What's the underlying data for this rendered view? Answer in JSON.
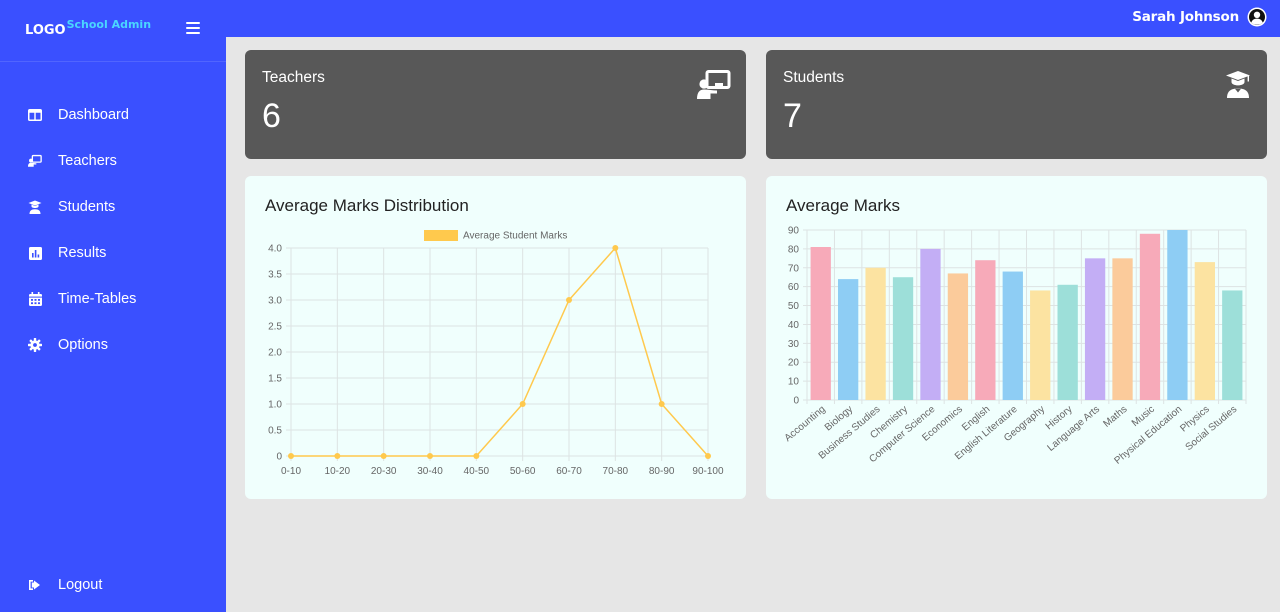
{
  "brand": {
    "logo": "LOGO",
    "app_name": "School Admin"
  },
  "sidebar": {
    "items": [
      {
        "label": "Dashboard",
        "icon": "dashboard-icon"
      },
      {
        "label": "Teachers",
        "icon": "teacher-icon"
      },
      {
        "label": "Students",
        "icon": "student-icon"
      },
      {
        "label": "Results",
        "icon": "chart-icon"
      },
      {
        "label": "Time-Tables",
        "icon": "calendar-icon"
      },
      {
        "label": "Options",
        "icon": "gear-icon"
      }
    ],
    "logout_label": "Logout"
  },
  "user": {
    "name": "Sarah Johnson"
  },
  "stats": {
    "teachers": {
      "title": "Teachers",
      "value": "6"
    },
    "students": {
      "title": "Students",
      "value": "7"
    }
  },
  "charts": {
    "distribution_title": "Average Marks Distribution",
    "marks_title": "Average Marks"
  },
  "colors": {
    "primary": "#3a50ff",
    "card_dark": "#585858",
    "chart_bg": "#f0fffd",
    "line": "#ffc94d"
  },
  "chart_data": [
    {
      "type": "line",
      "title": "Average Marks Distribution",
      "categories": [
        "0-10",
        "10-20",
        "20-30",
        "30-40",
        "40-50",
        "50-60",
        "60-70",
        "70-80",
        "80-90",
        "90-100"
      ],
      "series": [
        {
          "name": "Average Student Marks",
          "values": [
            0,
            0,
            0,
            0,
            0,
            1,
            3,
            4,
            1,
            0
          ]
        }
      ],
      "ylim": [
        0,
        4
      ],
      "yticks": [
        "0",
        "0.5",
        "1.0",
        "1.5",
        "2.0",
        "2.5",
        "3.0",
        "3.5",
        "4.0"
      ],
      "grid": true,
      "legend": "top"
    },
    {
      "type": "bar",
      "title": "Average Marks",
      "categories": [
        "Accounting",
        "Biology",
        "Business Studies",
        "Chemistry",
        "Computer Science",
        "Economics",
        "English",
        "English Literature",
        "Geography",
        "History",
        "Language Arts",
        "Maths",
        "Music",
        "Physical Education",
        "Physics",
        "Social Studies"
      ],
      "values": [
        81,
        64,
        70,
        65,
        80,
        67,
        74,
        68,
        58,
        61,
        75,
        75,
        88,
        90,
        73,
        58
      ],
      "ylim": [
        0,
        90
      ],
      "yticks": [
        "0",
        "10",
        "20",
        "30",
        "40",
        "50",
        "60",
        "70",
        "80",
        "90"
      ],
      "bar_colors": [
        "#f7aab9",
        "#8ecdf4",
        "#fce3a1",
        "#9ddfd9",
        "#c3aef5",
        "#fbcb9b",
        "#f7aab9",
        "#8ecdf4",
        "#fce3a1",
        "#9ddfd9",
        "#c3aef5",
        "#fbcb9b",
        "#f7aab9",
        "#8ecdf4",
        "#fce3a1",
        "#9ddfd9"
      ],
      "grid": true
    }
  ]
}
